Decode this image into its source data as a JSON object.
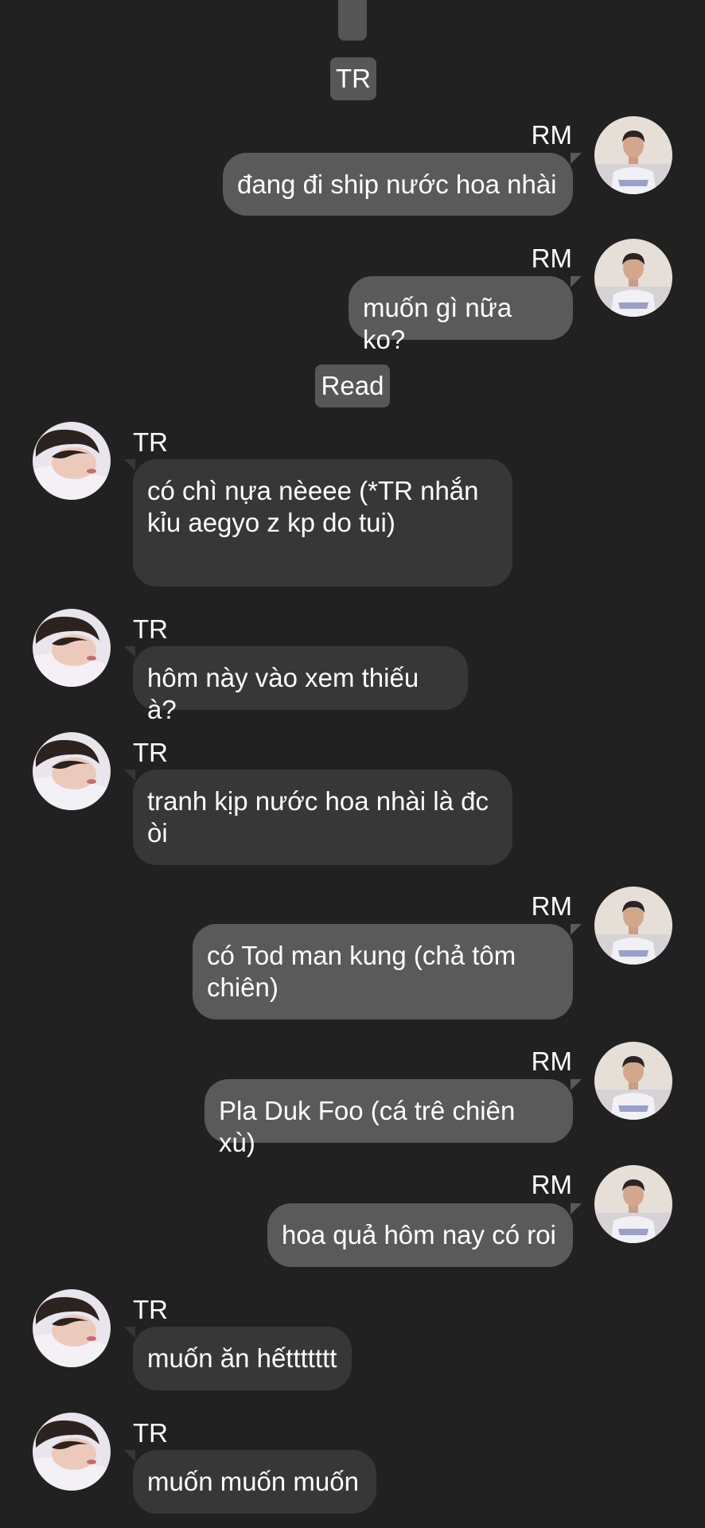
{
  "top_pill": {
    "label": "TR"
  },
  "read_pill": {
    "label": "Read"
  },
  "messages": [
    {
      "sender": "RM",
      "avatar": "rm-avatar-icon",
      "text": "đang đi ship nước hoa nhài"
    },
    {
      "sender": "RM",
      "avatar": "rm-avatar-icon",
      "text": "muốn gì nữa ko?"
    },
    {
      "sender": "TR",
      "avatar": "tr-avatar-icon",
      "text": "có chì nựa nèeee (*TR nhắn kỉu aegyo z kp do tui)"
    },
    {
      "sender": "TR",
      "avatar": "tr-avatar-icon",
      "text": "hôm này vào xem thiếu à?"
    },
    {
      "sender": "TR",
      "avatar": "tr-avatar-icon",
      "text": "tranh kịp nước hoa nhài là đc òi"
    },
    {
      "sender": "RM",
      "avatar": "rm-avatar-icon",
      "text": "có Tod man kung (chả tôm chiên)"
    },
    {
      "sender": "RM",
      "avatar": "rm-avatar-icon",
      "text": "Pla Duk Foo (cá trê chiên xù)"
    },
    {
      "sender": "RM",
      "avatar": "rm-avatar-icon",
      "text": "hoa quả hôm nay có roi"
    },
    {
      "sender": "TR",
      "avatar": "tr-avatar-icon",
      "text": "muốn ăn hếttttttt"
    },
    {
      "sender": "TR",
      "avatar": "tr-avatar-icon",
      "text": "muốn muốn muốn"
    }
  ],
  "colors": {
    "background": "#212121",
    "outgoing_bubble": "#5a5a5a",
    "incoming_bubble": "#373737",
    "pill": "#575757",
    "text": "#ffffff"
  }
}
